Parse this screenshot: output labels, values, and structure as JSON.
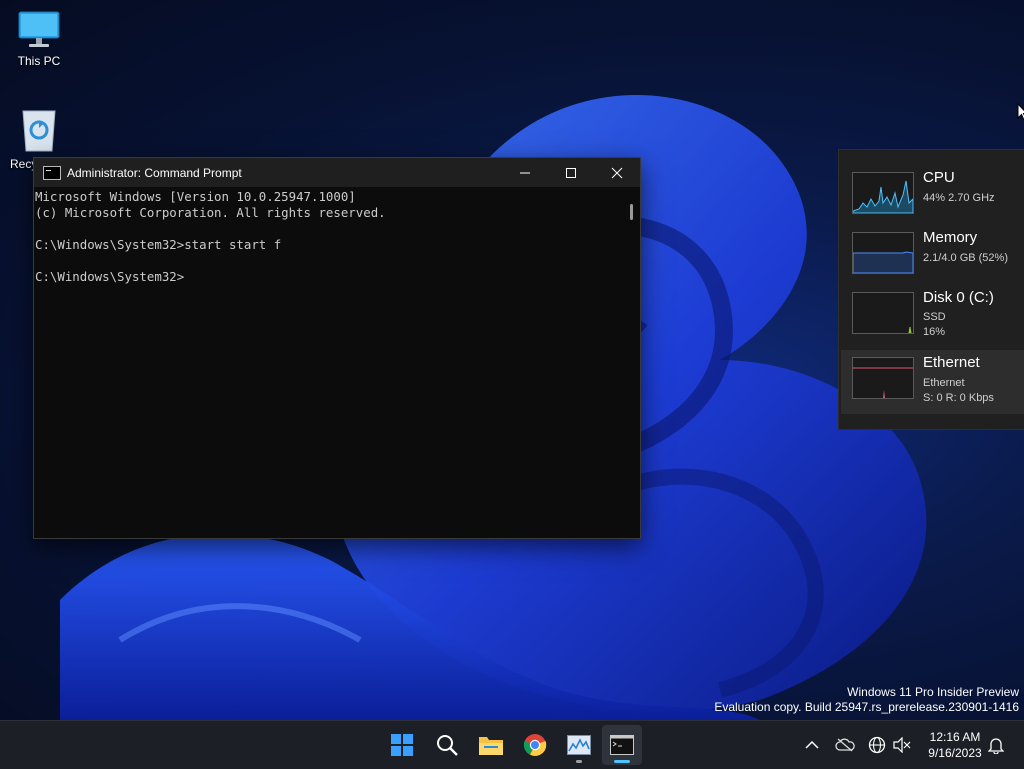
{
  "desktop": {
    "icons": [
      {
        "label": "This PC"
      },
      {
        "label": "Recy"
      }
    ]
  },
  "cmd_window": {
    "title": "Administrator: Command Prompt",
    "lines": [
      "Microsoft Windows [Version 10.0.25947.1000]",
      "(c) Microsoft Corporation. All rights reserved.",
      "",
      "C:\\Windows\\System32>start start f",
      "",
      "C:\\Windows\\System32>"
    ]
  },
  "perf_widget": {
    "items": [
      {
        "name": "CPU",
        "sub1": "44% 2.70 GHz",
        "sub2": "",
        "color": "#4cc2ff"
      },
      {
        "name": "Memory",
        "sub1": "2.1/4.0 GB (52%)",
        "sub2": "",
        "color": "#4c8cff"
      },
      {
        "name": "Disk 0 (C:)",
        "sub1": "SSD",
        "sub2": "16%",
        "color": "#8dc63f"
      },
      {
        "name": "Ethernet",
        "sub1": "Ethernet",
        "sub2": "S: 0 R: 0 Kbps",
        "color": "#e0557a"
      }
    ]
  },
  "watermark": {
    "line1": "Windows 11 Pro Insider Preview",
    "line2": "Evaluation copy. Build 25947.rs_prerelease.230901-1416"
  },
  "taskbar": {
    "apps": [
      {
        "icon": "windows-start-icon"
      },
      {
        "icon": "search-icon"
      },
      {
        "icon": "file-explorer-icon"
      },
      {
        "icon": "chrome-icon"
      },
      {
        "icon": "task-manager-icon"
      },
      {
        "icon": "command-prompt-icon"
      }
    ],
    "accent": "#4cc2ff"
  },
  "tray": {
    "time": "12:16 AM",
    "date": "9/16/2023"
  }
}
